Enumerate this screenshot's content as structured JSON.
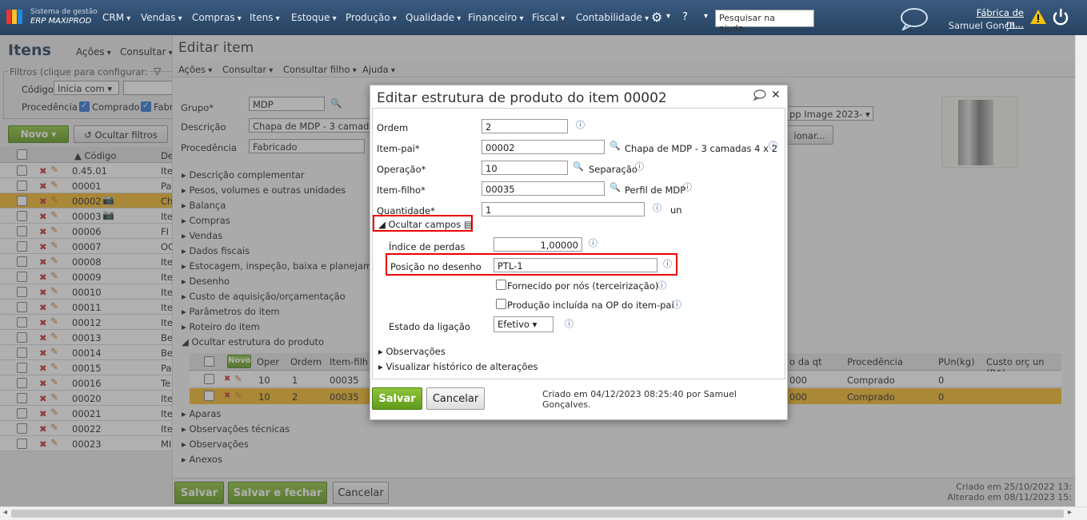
{
  "topbar": {
    "brand_line1": "Sistema de gestão",
    "brand_line2": "ERP MAXIPROD",
    "menus": [
      "CRM",
      "Vendas",
      "Compras",
      "Itens",
      "Estoque",
      "Produção",
      "Qualidade",
      "Financeiro",
      "Fiscal",
      "Contabilidade"
    ],
    "help_search_placeholder": "Pesquisar na ajuda...",
    "company": "Fábrica de m...",
    "user": "Samuel Gonça..."
  },
  "left": {
    "title": "Itens",
    "actions": "Ações",
    "consult": "Consultar",
    "filters_label": "Filtros (clique para configurar:",
    "code_label": "Código",
    "code_mode": "Inicia com",
    "origin_label": "Procedência",
    "origin_purchased": "Comprado",
    "origin_fab": "Fabr",
    "new_label": "Novo",
    "hide_filters": "Ocultar filtros",
    "col_code": "▲ Código",
    "col_desc": "De",
    "rows": [
      {
        "code": "0.45.01",
        "d": "Ite"
      },
      {
        "code": "00001",
        "d": "Pa"
      },
      {
        "code": "00002",
        "d": "Ch"
      },
      {
        "code": "00003",
        "d": "Ite"
      },
      {
        "code": "00006",
        "d": "FI"
      },
      {
        "code": "00007",
        "d": "OC"
      },
      {
        "code": "00008",
        "d": "Ite"
      },
      {
        "code": "00009",
        "d": "Ite"
      },
      {
        "code": "00010",
        "d": "Ite"
      },
      {
        "code": "00011",
        "d": "Ite"
      },
      {
        "code": "00012",
        "d": "Ite"
      },
      {
        "code": "00013",
        "d": "Be"
      },
      {
        "code": "00014",
        "d": "Be"
      },
      {
        "code": "00015",
        "d": "Pa"
      },
      {
        "code": "00016",
        "d": "Te"
      },
      {
        "code": "00020",
        "d": "Ite"
      },
      {
        "code": "00021",
        "d": "Ite"
      },
      {
        "code": "00022",
        "d": "Ite"
      },
      {
        "code": "00023",
        "d": "MI"
      }
    ]
  },
  "main": {
    "title": "Editar item",
    "menus": [
      "Ações",
      "Consultar",
      "Consultar filho",
      "Ajuda"
    ],
    "group_label": "Grupo*",
    "group_value": "MDP",
    "desc_label": "Descrição",
    "desc_value": "Chapa de MDP - 3 camadas",
    "origin_label": "Procedência",
    "origin_value": "Fabricado",
    "image_select": "pp Image 2023-",
    "image_btn": "ionar...",
    "sections": [
      "Descrição complementar",
      "Pesos, volumes e outras unidades",
      "Balança",
      "Compras",
      "Vendas",
      "Dados fiscais",
      "Estocagem, inspeção, baixa e planejamen",
      "Desenho",
      "Custo de aquisição/orçamentação",
      "Parâmetros do item",
      "Roteiro do item",
      "Ocultar estrutura do produto"
    ],
    "sections_after": [
      "Aparas",
      "Observações técnicas",
      "Observações",
      "Anexos"
    ],
    "grid_headers": [
      "Novo",
      "Oper",
      "Ordem",
      "Item-filh"
    ],
    "grid_headers_right": [
      "o da qt",
      "Procedência",
      "PUn(kg)",
      "Custo orç un (R$)"
    ],
    "grid_rows": [
      {
        "oper": "10",
        "ordem": "1",
        "item": "00035",
        "qt": "000",
        "proc": "Comprado",
        "pun": "0"
      },
      {
        "oper": "10",
        "ordem": "2",
        "item": "00035",
        "qt": "000",
        "proc": "Comprado",
        "pun": "0"
      }
    ],
    "save": "Salvar",
    "save_close": "Salvar e fechar",
    "cancel": "Cancelar",
    "created": "Criado em 25/10/2022 13:",
    "altered": "Alterado em 08/11/2023 15:"
  },
  "modal": {
    "title": "Editar estrutura de produto do item 00002",
    "ordem_label": "Ordem",
    "ordem_value": "2",
    "parent_label": "Item-pai*",
    "parent_value": "00002",
    "parent_desc": "Chapa de MDP - 3 camadas 4 x 2",
    "op_label": "Operação*",
    "op_value": "10",
    "op_desc": "Separação",
    "child_label": "Item-filho*",
    "child_value": "00035",
    "child_desc": "Perfil de MDP",
    "qty_label": "Quantidade*",
    "qty_value": "1",
    "qty_unit": "un",
    "hide_fields": "Ocultar campos",
    "loss_label": "Índice de perdas",
    "loss_value": "1,00000",
    "pos_label": "Posição no desenho",
    "pos_value": "PTL-1",
    "supplied": "Fornecido por nós (terceirização)",
    "included": "Produção incluída na OP do item-pai",
    "link_label": "Estado da ligação",
    "link_value": "Efetivo",
    "obs": "Observações",
    "history": "Visualizar histórico de alterações",
    "save": "Salvar",
    "cancel": "Cancelar",
    "created": "Criado em 04/12/2023 08:25:40 por Samuel Gonçalves."
  }
}
